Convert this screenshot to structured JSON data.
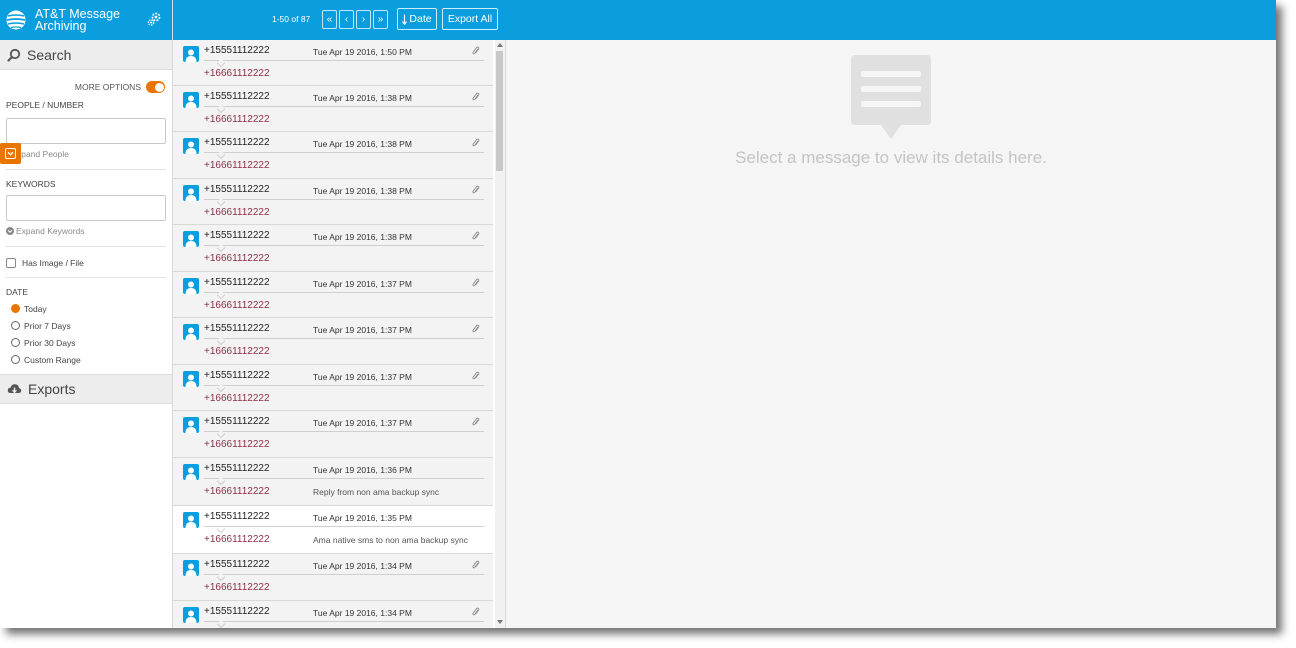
{
  "app": {
    "title_line1": "AT&T Message",
    "title_line2": "Archiving"
  },
  "search": {
    "title": "Search",
    "more_options_label": "MORE OPTIONS",
    "people_label": "PEOPLE / NUMBER",
    "people_value": "",
    "expand_people": "xpand People",
    "keywords_label": "KEYWORDS",
    "keywords_value": "",
    "expand_keywords": "Expand Keywords",
    "has_image_label": "Has Image / File",
    "date_label": "DATE",
    "date_options": [
      "Today",
      "Prior 7 Days",
      "Prior 30 Days",
      "Custom Range"
    ],
    "date_selected": "Today"
  },
  "exports": {
    "title": "Exports"
  },
  "toolbar": {
    "pager": "1-50 of 87",
    "first": "«",
    "prev": "‹",
    "next": "›",
    "last": "»",
    "sort_label": "Date",
    "export_all": "Export All"
  },
  "messages": [
    {
      "from": "+15551112222",
      "date": "Tue Apr 19 2016, 1:50 PM",
      "to": "+16661112222",
      "preview": "",
      "attachment": true
    },
    {
      "from": "+15551112222",
      "date": "Tue Apr 19 2016, 1:38 PM",
      "to": "+16661112222",
      "preview": "",
      "attachment": true
    },
    {
      "from": "+15551112222",
      "date": "Tue Apr 19 2016, 1:38 PM",
      "to": "+16661112222",
      "preview": "",
      "attachment": true
    },
    {
      "from": "+15551112222",
      "date": "Tue Apr 19 2016, 1:38 PM",
      "to": "+16661112222",
      "preview": "",
      "attachment": true
    },
    {
      "from": "+15551112222",
      "date": "Tue Apr 19 2016, 1:38 PM",
      "to": "+16661112222",
      "preview": "",
      "attachment": true
    },
    {
      "from": "+15551112222",
      "date": "Tue Apr 19 2016, 1:37 PM",
      "to": "+16661112222",
      "preview": "",
      "attachment": true
    },
    {
      "from": "+15551112222",
      "date": "Tue Apr 19 2016, 1:37 PM",
      "to": "+16661112222",
      "preview": "",
      "attachment": true
    },
    {
      "from": "+15551112222",
      "date": "Tue Apr 19 2016, 1:37 PM",
      "to": "+16661112222",
      "preview": "",
      "attachment": true
    },
    {
      "from": "+15551112222",
      "date": "Tue Apr 19 2016, 1:37 PM",
      "to": "+16661112222",
      "preview": "",
      "attachment": true
    },
    {
      "from": "+15551112222",
      "date": "Tue Apr 19 2016, 1:36 PM",
      "to": "+16661112222",
      "preview": "Reply from non ama backup sync",
      "attachment": false
    },
    {
      "from": "+15551112222",
      "date": "Tue Apr 19 2016, 1:35 PM",
      "to": "+16661112222",
      "preview": "Ama native sms to non ama backup sync",
      "attachment": false
    },
    {
      "from": "+15551112222",
      "date": "Tue Apr 19 2016, 1:34 PM",
      "to": "+16661112222",
      "preview": "",
      "attachment": true
    },
    {
      "from": "+15551112222",
      "date": "Tue Apr 19 2016, 1:34 PM",
      "to": "",
      "preview": "",
      "attachment": true
    }
  ],
  "detail": {
    "empty_message": "Select a message to view its details here."
  },
  "colors": {
    "brand_blue": "#0a9ede",
    "accent_orange": "#ea7400",
    "recipient": "#8a3046"
  }
}
